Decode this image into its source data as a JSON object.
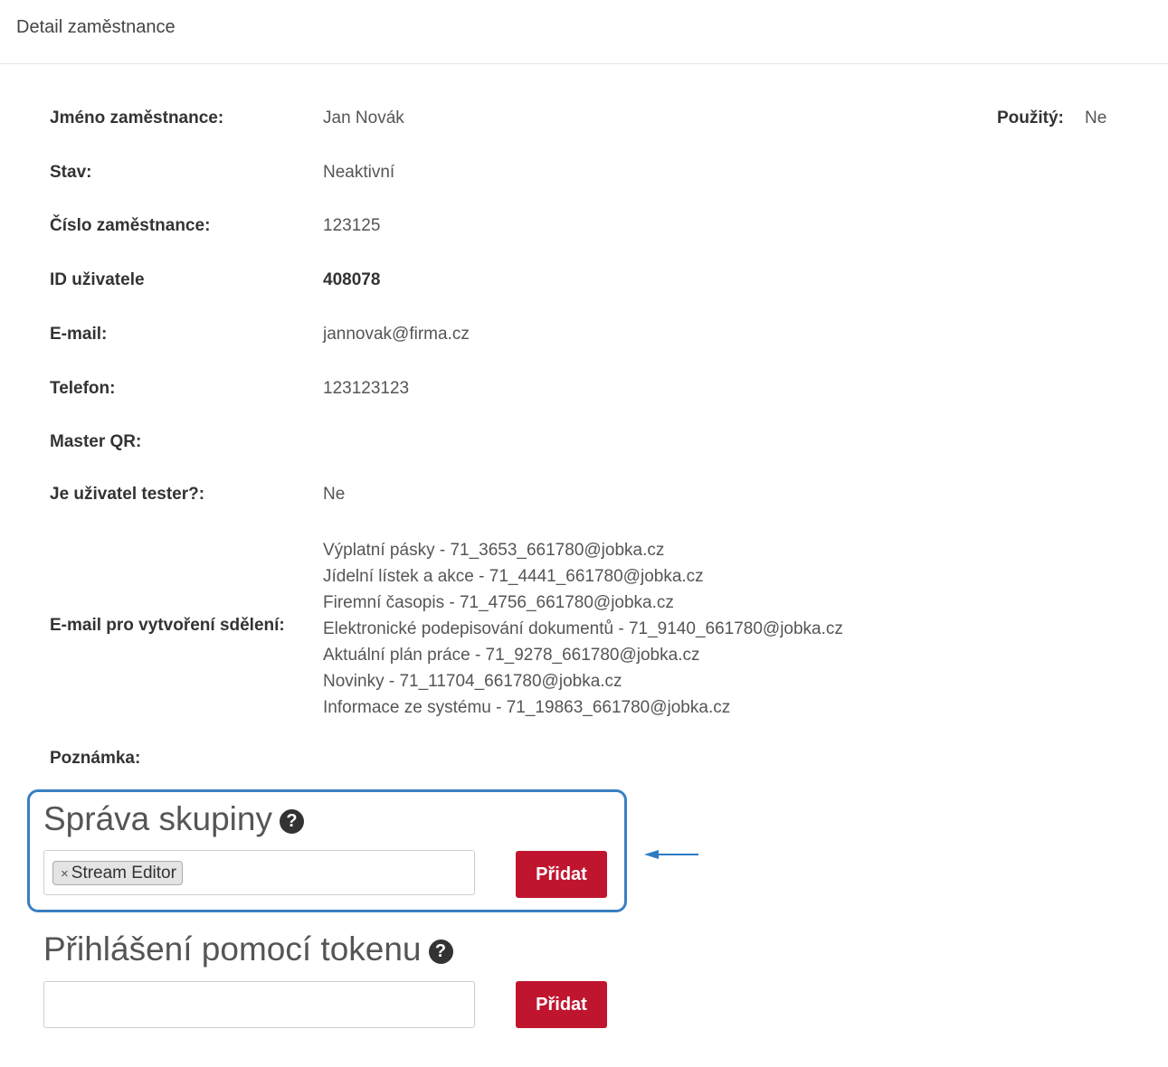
{
  "header": {
    "title": "Detail zaměstnance"
  },
  "details": {
    "name_label": "Jméno zaměstnance:",
    "name_value": "Jan Novák",
    "status_label": "Stav:",
    "status_value": "Neaktivní",
    "number_label": "Číslo zaměstnance:",
    "number_value": "123125",
    "userid_label": "ID uživatele",
    "userid_value": "408078",
    "email_label": "E-mail:",
    "email_value": "jannovak@firma.cz",
    "phone_label": "Telefon:",
    "phone_value": "123123123",
    "masterqr_label": "Master QR:",
    "masterqr_value": "",
    "tester_label": "Je uživatel tester?:",
    "tester_value": "Ne",
    "used_label": "Použitý:",
    "used_value": "Ne",
    "message_emails_label": "E-mail pro vytvoření sdělení:",
    "message_emails": [
      "Výplatní pásky - 71_3653_661780@jobka.cz",
      "Jídelní lístek a akce - 71_4441_661780@jobka.cz",
      "Firemní časopis - 71_4756_661780@jobka.cz",
      "Elektronické podepisování dokumentů - 71_9140_661780@jobka.cz",
      "Aktuální plán práce - 71_9278_661780@jobka.cz",
      "Novinky - 71_11704_661780@jobka.cz",
      "Informace ze systému - 71_19863_661780@jobka.cz"
    ],
    "note_label": "Poznámka:"
  },
  "group_management": {
    "title": "Správa skupiny",
    "help_glyph": "?",
    "tags": [
      {
        "remove": "×",
        "label": "Stream Editor"
      }
    ],
    "add_button": "Přidat"
  },
  "token_login": {
    "title": "Přihlášení pomocí tokenu",
    "help_glyph": "?",
    "input_value": "",
    "add_button": "Přidat"
  },
  "colors": {
    "accent_button": "#c0152f",
    "highlight_border": "#3a7fc1",
    "annotation_arrow": "#2e7bc4"
  }
}
